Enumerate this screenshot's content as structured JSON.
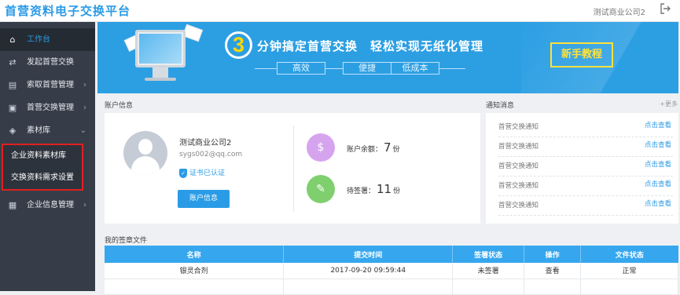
{
  "header": {
    "title": "首营资料电子交换平台",
    "company": "测试商业公司2",
    "logout_icon": "logout-icon"
  },
  "sidebar": {
    "items": [
      {
        "label": "工作台",
        "icon": "home-icon",
        "active": true
      },
      {
        "label": "发起首营交换",
        "icon": "exchange-icon"
      },
      {
        "label": "索取首营管理",
        "icon": "request-icon",
        "arrow": "›"
      },
      {
        "label": "首营交换管理",
        "icon": "clipboard-icon",
        "arrow": "›"
      },
      {
        "label": "素材库",
        "icon": "layers-icon",
        "arrow": "⌄",
        "expanded": true
      },
      {
        "label": "企业信息管理",
        "icon": "building-icon",
        "arrow": "›"
      }
    ],
    "sub_items": [
      {
        "label": "企业资料素材库"
      },
      {
        "label": "交换资料需求设置"
      }
    ]
  },
  "banner": {
    "number": "3",
    "title": "分钟搞定首营交换　轻松实现无纸化管理",
    "tags": [
      "高效",
      "便捷",
      "低成本"
    ],
    "button": "新手教程",
    "color": "#2c9fe3"
  },
  "account": {
    "section_title": "账户信息",
    "name": "测试商业公司2",
    "email": "sygs002@qq.com",
    "cert_status": "证书已认证",
    "button": "账户信息",
    "balance_label": "账户余额：",
    "balance_value": "7",
    "balance_unit": "份",
    "pending_label": "待签署：",
    "pending_value": "11",
    "pending_unit": "份"
  },
  "notices": {
    "section_title": "通知消息",
    "more": "+更多",
    "items": [
      {
        "text": "首营交换通知",
        "link": "点击查看"
      },
      {
        "text": "首营交换通知",
        "link": "点击查看"
      },
      {
        "text": "首营交换通知",
        "link": "点击查看"
      },
      {
        "text": "首营交换通知",
        "link": "点击查看"
      },
      {
        "text": "首营交换通知",
        "link": "点击查看"
      }
    ]
  },
  "documents": {
    "section_title": "我的签章文件",
    "columns": [
      "名称",
      "提交时间",
      "签署状态",
      "操作",
      "文件状态"
    ],
    "rows": [
      [
        "银灵合剂",
        "2017-09-20 09:59:44",
        "未签署",
        "查看",
        "正常"
      ],
      [
        "",
        "",
        "",
        "",
        ""
      ]
    ]
  },
  "colors": {
    "accent": "#2a9be6",
    "sidebar": "#363d48",
    "highlight": "#e02020"
  }
}
